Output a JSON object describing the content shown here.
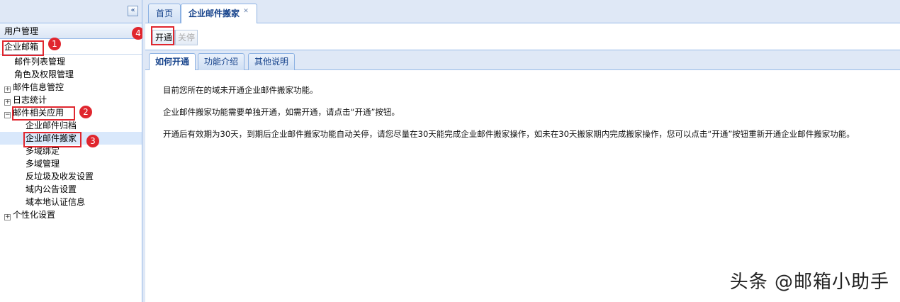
{
  "sidebar": {
    "collapse_glyph": "«",
    "accordion_user": "用户管理",
    "accordion_mail": "企业邮箱",
    "tree": {
      "mail_list": "邮件列表管理",
      "roles": "角色及权限管理",
      "mail_info": "邮件信息管控",
      "log_stats": "日志统计",
      "mail_apps": "邮件相关应用",
      "archive": "企业邮件归档",
      "migration": "企业邮件搬家",
      "multi_bind": "多域绑定",
      "multi_manage": "多域管理",
      "antispam": "反垃圾及收发设置",
      "announce": "域内公告设置",
      "local_auth": "域本地认证信息",
      "personal": "个性化设置"
    },
    "expander_plus": "+",
    "expander_minus": "−"
  },
  "tabs": {
    "home": "首页",
    "migration": "企业邮件搬家",
    "close_glyph": "✕"
  },
  "toolbar": {
    "open": "开通",
    "close": "关停"
  },
  "subtabs": {
    "how": "如何开通",
    "intro": "功能介绍",
    "other": "其他说明"
  },
  "content": {
    "line1": "目前您所在的域未开通企业邮件搬家功能。",
    "line2": "企业邮件搬家功能需要单独开通，如需开通，请点击“开通”按钮。",
    "line3": "开通后有效期为30天，到期后企业邮件搬家功能自动关停，请您尽量在30天能完成企业邮件搬家操作，如未在30天搬家期内完成搬家操作，您可以点击“开通”按钮重新开通企业邮件搬家功能。"
  },
  "annotations": {
    "one": "1",
    "two": "2",
    "three": "3",
    "four": "4"
  },
  "watermark": "头条 @邮箱小助手",
  "colors": {
    "annotation_red": "#e0262e",
    "panel_blue": "#dfe8f6",
    "border_blue": "#99bbe8",
    "tab_text": "#15428b"
  }
}
